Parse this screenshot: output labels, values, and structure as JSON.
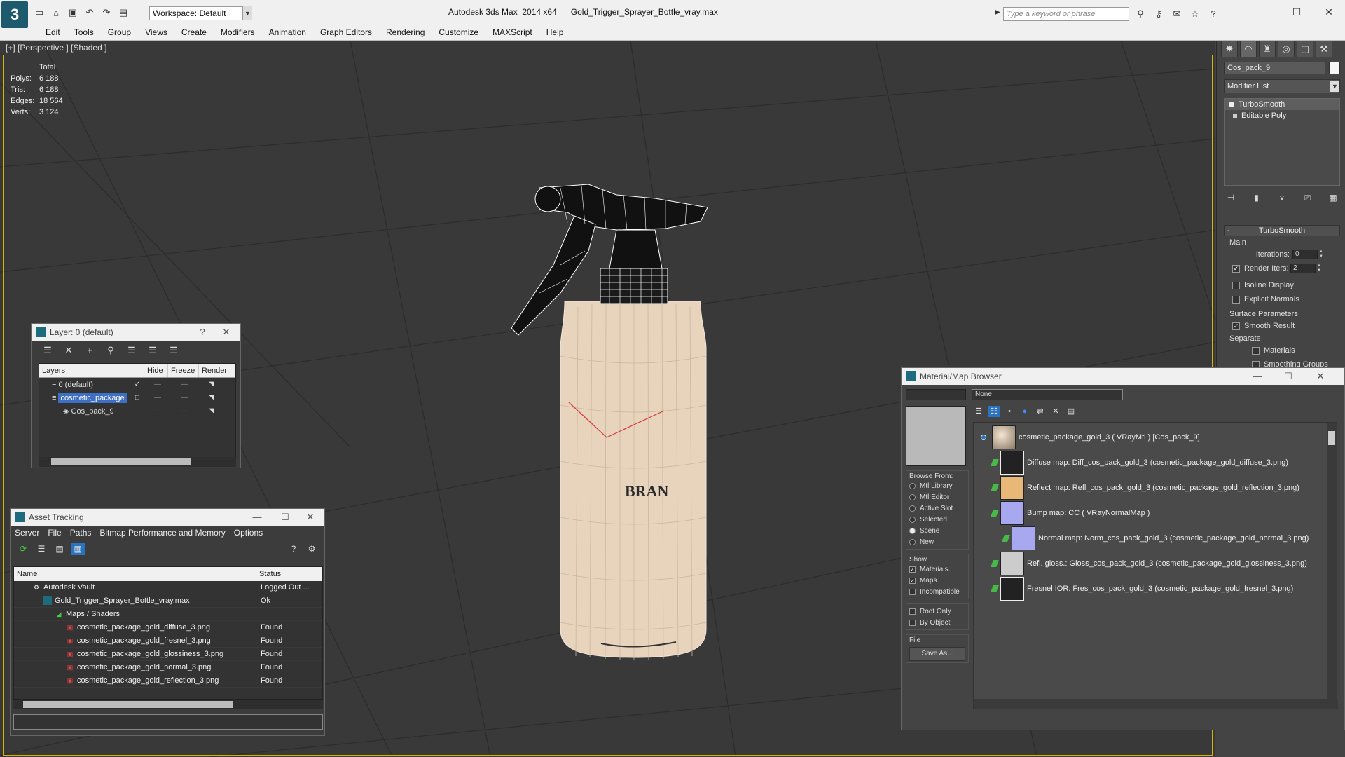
{
  "title_bar": {
    "app_title": "Autodesk 3ds Max  2014 x64",
    "file_name": "Gold_Trigger_Sprayer_Bottle_vray.max",
    "workspace": "Workspace: Default",
    "search_placeholder": "Type a keyword or phrase",
    "logo_glyph": "3"
  },
  "menu": [
    "Edit",
    "Tools",
    "Group",
    "Views",
    "Create",
    "Modifiers",
    "Animation",
    "Graph Editors",
    "Rendering",
    "Customize",
    "MAXScript",
    "Help"
  ],
  "viewport": {
    "label": "[+] [Perspective ] [Shaded ]",
    "stats_header": "Total",
    "stats": [
      {
        "label": "Polys:",
        "value": "6 188"
      },
      {
        "label": "Tris:",
        "value": "6 188"
      },
      {
        "label": "Edges:",
        "value": "18 564"
      },
      {
        "label": "Verts:",
        "value": "3 124"
      }
    ],
    "brand_text": "BRAN"
  },
  "command_panel": {
    "object_name": "Cos_pack_9",
    "modifier_list": "Modifier List",
    "stack": [
      "TurboSmooth",
      "Editable Poly"
    ],
    "rollout_title": "TurboSmooth",
    "main_label": "Main",
    "iterations_label": "Iterations:",
    "iterations_value": "0",
    "render_iters_label": "Render Iters:",
    "render_iters_value": "2",
    "isoline_label": "Isoline Display",
    "explicit_normals_label": "Explicit Normals",
    "surface_params_label": "Surface Parameters",
    "smooth_result_label": "Smooth Result",
    "separate_label": "Separate",
    "materials_label": "Materials",
    "smoothing_groups_label": "Smoothing Groups"
  },
  "layer_window": {
    "title": "Layer: 0 (default)",
    "help": "?",
    "headers": [
      "Layers",
      "Hide",
      "Freeze",
      "Render"
    ],
    "rows": [
      {
        "name": "0 (default)",
        "mark": "✓"
      },
      {
        "name": "cosmetic_package",
        "mark": "□"
      },
      {
        "name": "Cos_pack_9",
        "mark": ""
      }
    ]
  },
  "asset_tracking": {
    "title": "Asset Tracking",
    "menu": [
      "Server",
      "File",
      "Paths",
      "Bitmap Performance and Memory",
      "Options"
    ],
    "headers": {
      "name": "Name",
      "status": "Status"
    },
    "rows": [
      {
        "name": "Autodesk Vault",
        "status": "Logged Out ..."
      },
      {
        "name": "Gold_Trigger_Sprayer_Bottle_vray.max",
        "status": "Ok"
      },
      {
        "name": "Maps / Shaders",
        "status": ""
      },
      {
        "name": "cosmetic_package_gold_diffuse_3.png",
        "status": "Found"
      },
      {
        "name": "cosmetic_package_gold_fresnel_3.png",
        "status": "Found"
      },
      {
        "name": "cosmetic_package_gold_glossiness_3.png",
        "status": "Found"
      },
      {
        "name": "cosmetic_package_gold_normal_3.png",
        "status": "Found"
      },
      {
        "name": "cosmetic_package_gold_reflection_3.png",
        "status": "Found"
      }
    ]
  },
  "material_browser": {
    "title": "Material/Map Browser",
    "filter_value": "None",
    "browse_from_label": "Browse From:",
    "browse_from": [
      "Mtl Library",
      "Mtl Editor",
      "Active Slot",
      "Selected",
      "Scene",
      "New"
    ],
    "browse_selected": "Scene",
    "show_label": "Show",
    "show": [
      {
        "label": "Materials",
        "checked": true
      },
      {
        "label": "Maps",
        "checked": true
      },
      {
        "label": "Incompatible",
        "checked": false
      }
    ],
    "extra": [
      {
        "label": "Root Only",
        "checked": false
      },
      {
        "label": "By Object",
        "checked": false
      }
    ],
    "file_label": "File",
    "save_as": "Save As...",
    "items": [
      "cosmetic_package_gold_3  ( VRayMtl )  [Cos_pack_9]",
      "Diffuse map: Diff_cos_pack_gold_3 (cosmetic_package_gold_diffuse_3.png)",
      "Reflect map: Refl_cos_pack_gold_3 (cosmetic_package_gold_reflection_3.png)",
      "Bump map: CC  ( VRayNormalMap )",
      "Normal map: Norm_cos_pack_gold_3 (cosmetic_package_gold_normal_3.png)",
      "Refl. gloss.: Gloss_cos_pack_gold_3 (cosmetic_package_gold_glossiness_3.png)",
      "Fresnel IOR: Fres_cos_pack_gold_3 (cosmetic_package_gold_fresnel_3.png)"
    ],
    "colors": {
      "bump": "#a8a8f0",
      "reflect": "#e8b878",
      "preview": "#b9b9b9"
    }
  }
}
